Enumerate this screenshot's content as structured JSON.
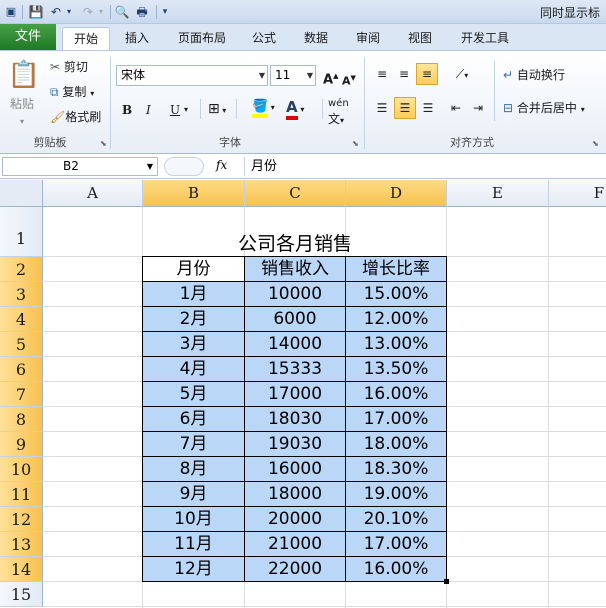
{
  "titlebar": {
    "window_title": "同时显示标",
    "qa_save": "💾",
    "qa_undo": "↶",
    "qa_redo": "↷",
    "qa_preview": "🔍",
    "qa_print": "🖶",
    "qa_more": "▾"
  },
  "tabs": {
    "file": "文件",
    "items": [
      "开始",
      "插入",
      "页面布局",
      "公式",
      "数据",
      "审阅",
      "视图",
      "开发工具"
    ],
    "active": "开始"
  },
  "ribbon": {
    "clipboard": {
      "paste": "粘贴",
      "cut": "剪切",
      "copy": "复制",
      "format_painter": "格式刷",
      "label": "剪贴板"
    },
    "font": {
      "name": "宋体",
      "size": "11",
      "grow": "A",
      "shrink": "A",
      "bold": "B",
      "italic": "I",
      "underline": "U",
      "border": "⊞",
      "fill": "A",
      "fontcolor": "A",
      "wen": "wén",
      "label": "字体"
    },
    "alignment": {
      "wrap": "自动换行",
      "merge": "合并后居中",
      "label": "对齐方式"
    }
  },
  "formula_bar": {
    "name_box": "B2",
    "fx": "fx",
    "content": "月份"
  },
  "columns": [
    "A",
    "B",
    "C",
    "D",
    "E",
    "F"
  ],
  "rows": [
    "1",
    "2",
    "3",
    "4",
    "5",
    "6",
    "7",
    "8",
    "9",
    "10",
    "11",
    "12",
    "13",
    "14",
    "15"
  ],
  "sheet": {
    "title": "公司各月销售",
    "headers": [
      "月份",
      "销售收入",
      "增长比率"
    ],
    "data": [
      [
        "1月",
        "10000",
        "15.00%"
      ],
      [
        "2月",
        "6000",
        "12.00%"
      ],
      [
        "3月",
        "14000",
        "13.00%"
      ],
      [
        "4月",
        "15333",
        "13.50%"
      ],
      [
        "5月",
        "17000",
        "16.00%"
      ],
      [
        "6月",
        "18030",
        "17.00%"
      ],
      [
        "7月",
        "19030",
        "18.00%"
      ],
      [
        "8月",
        "16000",
        "18.30%"
      ],
      [
        "9月",
        "18000",
        "19.00%"
      ],
      [
        "10月",
        "20000",
        "20.10%"
      ],
      [
        "11月",
        "21000",
        "17.00%"
      ],
      [
        "12月",
        "22000",
        "16.00%"
      ]
    ]
  },
  "colors": {
    "selected_header": "#f7c14e",
    "table_fill": "#bbd7f7",
    "file_tab": "#2e7d32"
  }
}
